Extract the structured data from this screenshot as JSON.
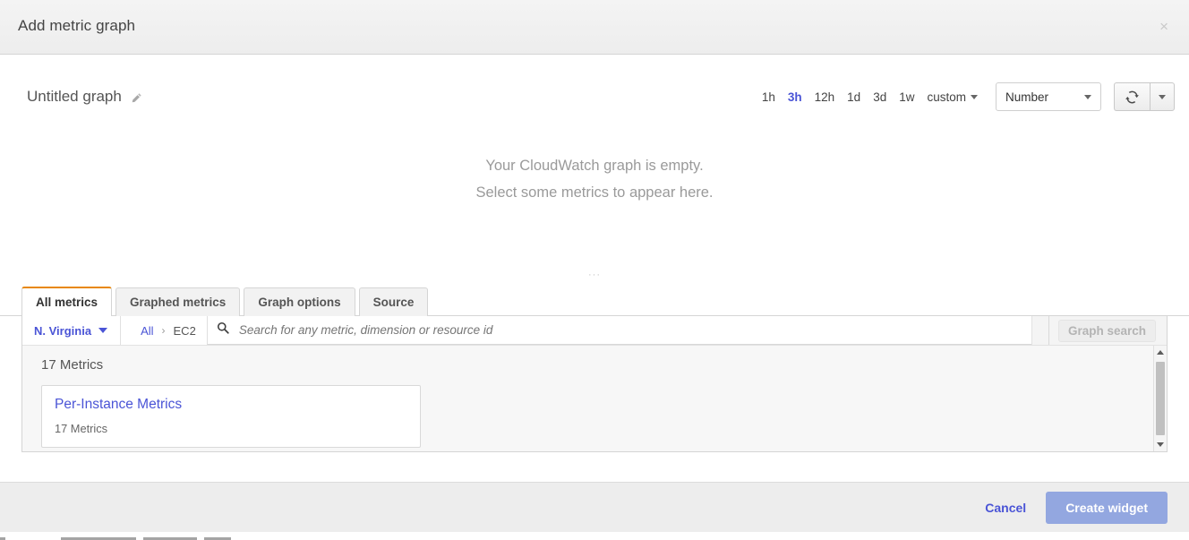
{
  "header": {
    "title": "Add metric graph",
    "close_label": "×"
  },
  "graph": {
    "title": "Untitled graph",
    "edit_icon": "pencil-icon",
    "empty_line1": "Your CloudWatch graph is empty.",
    "empty_line2": "Select some metrics to appear here.",
    "resize_grip": "···",
    "time_ranges": [
      {
        "label": "1h",
        "active": false
      },
      {
        "label": "3h",
        "active": true
      },
      {
        "label": "12h",
        "active": false
      },
      {
        "label": "1d",
        "active": false
      },
      {
        "label": "3d",
        "active": false
      },
      {
        "label": "1w",
        "active": false
      }
    ],
    "custom_label": "custom",
    "widget_type": "Number",
    "refresh_icon": "refresh-icon",
    "accent_color": "#4a54d6",
    "tab_accent_color": "#e8880a"
  },
  "tabs": [
    {
      "label": "All metrics",
      "active": true
    },
    {
      "label": "Graphed metrics",
      "active": false
    },
    {
      "label": "Graph options",
      "active": false
    },
    {
      "label": "Source",
      "active": false
    }
  ],
  "search": {
    "region": "N. Virginia",
    "breadcrumb": [
      {
        "label": "All",
        "link": true
      },
      {
        "label": "EC2",
        "link": false
      }
    ],
    "breadcrumb_separator": "›",
    "placeholder": "Search for any metric, dimension or resource id",
    "value": "",
    "graph_search_label": "Graph search",
    "search_icon": "search-icon"
  },
  "metrics": {
    "count_label": "17 Metrics",
    "cards": [
      {
        "title": "Per-Instance Metrics",
        "subtitle": "17 Metrics"
      }
    ]
  },
  "footer": {
    "cancel_label": "Cancel",
    "create_label": "Create widget"
  }
}
